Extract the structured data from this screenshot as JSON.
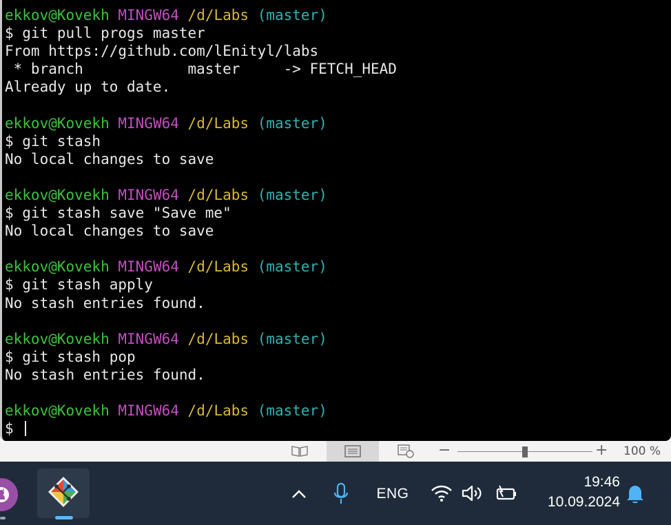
{
  "terminal": {
    "lines": [
      {
        "type": "prompt",
        "user": "ekkov@Kovekh",
        "system": "MINGW64",
        "path": "/d/Labs",
        "branch": "(master)"
      },
      {
        "type": "text",
        "text": "$ git pull progs master"
      },
      {
        "type": "text",
        "text": "From https://github.com/lEnityl/labs"
      },
      {
        "type": "text",
        "text": " * branch            master     -> FETCH_HEAD"
      },
      {
        "type": "text",
        "text": "Already up to date."
      },
      {
        "type": "blank"
      },
      {
        "type": "prompt",
        "user": "ekkov@Kovekh",
        "system": "MINGW64",
        "path": "/d/Labs",
        "branch": "(master)"
      },
      {
        "type": "text",
        "text": "$ git stash"
      },
      {
        "type": "text",
        "text": "No local changes to save"
      },
      {
        "type": "blank"
      },
      {
        "type": "prompt",
        "user": "ekkov@Kovekh",
        "system": "MINGW64",
        "path": "/d/Labs",
        "branch": "(master)"
      },
      {
        "type": "text",
        "text": "$ git stash save \"Save me\""
      },
      {
        "type": "text",
        "text": "No local changes to save"
      },
      {
        "type": "blank"
      },
      {
        "type": "prompt",
        "user": "ekkov@Kovekh",
        "system": "MINGW64",
        "path": "/d/Labs",
        "branch": "(master)"
      },
      {
        "type": "text",
        "text": "$ git stash apply"
      },
      {
        "type": "text",
        "text": "No stash entries found."
      },
      {
        "type": "blank"
      },
      {
        "type": "prompt",
        "user": "ekkov@Kovekh",
        "system": "MINGW64",
        "path": "/d/Labs",
        "branch": "(master)"
      },
      {
        "type": "text",
        "text": "$ git stash pop"
      },
      {
        "type": "text",
        "text": "No stash entries found."
      },
      {
        "type": "blank"
      },
      {
        "type": "prompt",
        "user": "ekkov@Kovekh",
        "system": "MINGW64",
        "path": "/d/Labs",
        "branch": "(master)"
      },
      {
        "type": "input",
        "text": "$ "
      }
    ],
    "colors": {
      "background": "#000000",
      "text": "#e8e8e8",
      "user": "#3cc33c",
      "system": "#c04fc0",
      "path": "#d8b832",
      "branch": "#2fb3b3"
    }
  },
  "statusbar": {
    "icons": [
      "read-mode-icon",
      "print-layout-icon",
      "web-layout-icon"
    ],
    "zoom_minus": "−",
    "zoom_plus": "+",
    "zoom_level": "100 %",
    "zoom_fraction": 0.5
  },
  "taskbar": {
    "apps": [
      "github-desktop-icon",
      "git-gui-icon"
    ],
    "tray": {
      "chevron": "chevron-up-icon",
      "mic": "microphone-icon",
      "language": "ENG",
      "wifi": "wifi-icon",
      "volume": "volume-icon",
      "battery": "battery-charging-icon"
    },
    "time": "19:46",
    "date": "10.09.2024",
    "notifications": "bell-icon"
  }
}
